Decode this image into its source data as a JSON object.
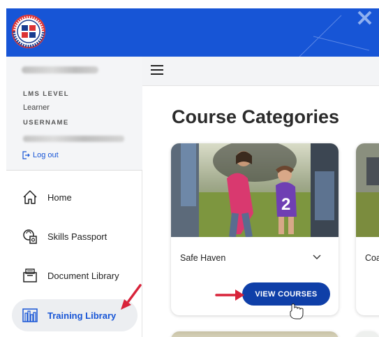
{
  "app": {
    "logo_alt": "AYSO"
  },
  "sidebar": {
    "profile": {
      "lms_level_label": "LMS LEVEL",
      "lms_level_value": "Learner",
      "username_label": "USERNAME",
      "logout_label": "Log out"
    },
    "items": [
      {
        "label": "Home",
        "icon": "home-icon",
        "active": false
      },
      {
        "label": "Skills Passport",
        "icon": "passport-icon",
        "active": false
      },
      {
        "label": "Document Library",
        "icon": "document-library-icon",
        "active": false
      },
      {
        "label": "Training Library",
        "icon": "training-library-icon",
        "active": true
      }
    ]
  },
  "main": {
    "title": "Course Categories",
    "cards": [
      {
        "name": "Safe Haven",
        "button_label": "VIEW COURSES"
      },
      {
        "name": "Coa"
      }
    ]
  },
  "colors": {
    "brand_blue": "#1755d6",
    "button_blue": "#0f3fa8",
    "annotation_red": "#d8233a"
  }
}
